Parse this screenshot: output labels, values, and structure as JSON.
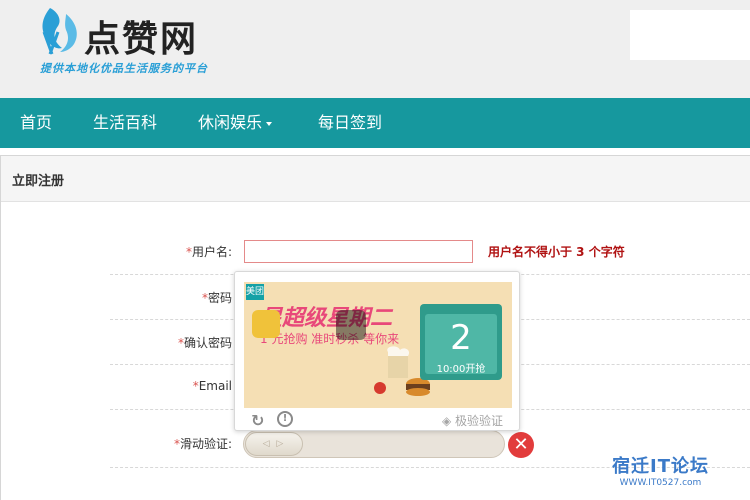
{
  "header": {
    "logo_text": "点赞网",
    "slogan": "提供本地化优品生活服务的平台"
  },
  "nav": {
    "items": [
      {
        "label": "首页"
      },
      {
        "label": "生活百科"
      },
      {
        "label": "休闲娱乐"
      },
      {
        "label": "每日签到"
      }
    ]
  },
  "panel": {
    "title": "立即注册"
  },
  "form": {
    "username_label": "用户名:",
    "username_value": "",
    "username_error": "用户名不得小于 3 个字符",
    "password_label": "密码",
    "confirm_label": "确认密码",
    "email_label": "Email",
    "slider_label": "滑动验证:",
    "required_mark": "*"
  },
  "captcha": {
    "promo_title": "星超级星期二",
    "promo_sub": "1 元抢购 准时秒杀 等你来",
    "promo_tag": "美团",
    "calendar_day": "2",
    "calendar_time": "10:00开抢",
    "brand": "极验验证",
    "state": "failed"
  },
  "watermark": {
    "main": "宿迁IT论坛",
    "sub": "WWW.IT0527.com"
  },
  "colors": {
    "nav_bg": "#16989e",
    "error": "#b01212",
    "fail": "#e23c3c"
  }
}
